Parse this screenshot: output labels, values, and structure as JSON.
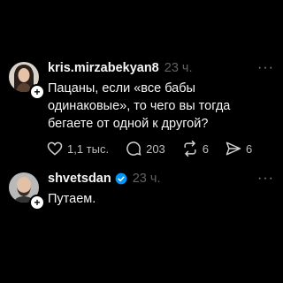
{
  "posts": [
    {
      "username": "kris.mirzabekyan8",
      "time": "23 ч.",
      "more_label": "···",
      "text": "Пацаны, если «все бабы одинаковые», то чего вы тогда бегаете от одной к другой?",
      "likes": "1,1 тыс.",
      "comments": "203",
      "reposts": "6",
      "shares": "6"
    },
    {
      "username": "shvetsdan",
      "verified": true,
      "time": "23 ч.",
      "more_label": "···",
      "text": "Путаем."
    }
  ],
  "colors": {
    "background": "#000000",
    "text": "#f3f5f7",
    "muted": "#616161",
    "verified_blue": "#0095f6"
  }
}
